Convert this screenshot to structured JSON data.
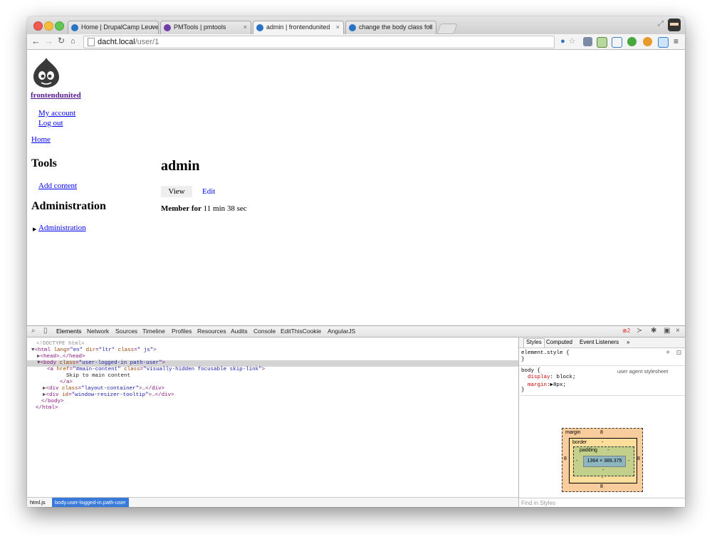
{
  "browser": {
    "tabs": [
      {
        "title": "Home | DrupalCamp Leuve",
        "close": "×",
        "color": "#2a73c4"
      },
      {
        "title": "PMTools | pmtools",
        "close": "×",
        "color": "#6f3fa8"
      },
      {
        "title": "admin | frontendunited",
        "close": "×",
        "color": "#2a73c4"
      },
      {
        "title": "change the body class foll",
        "close": "×",
        "color": "#2a73c4"
      }
    ],
    "url_host": "dacht.local",
    "url_path": "/user/1"
  },
  "page": {
    "site_name": "frontendunited",
    "user_menu": [
      "My account",
      "Log out"
    ],
    "breadcrumb": "Home",
    "tools_heading": "Tools",
    "add_content": "Add content",
    "admin_heading": "Administration",
    "admin_link": "Administration",
    "title": "admin",
    "local_tabs": [
      "View",
      "Edit"
    ],
    "member_label": "Member for",
    "member_value": " 11 min 38 sec"
  },
  "devtools": {
    "tabs": [
      "Elements",
      "Network",
      "Sources",
      "Timeline",
      "Profiles",
      "Resources",
      "Audits",
      "Console",
      "EditThisCookie",
      "AngularJS"
    ],
    "error_count": "2",
    "dom": {
      "doctype": "<!DOCTYPE html>",
      "html_open": "<html",
      "html_lang_attr": "lang",
      "html_lang_val": "\"en\"",
      "html_dir_attr": "dir",
      "html_dir_val": "\"ltr\"",
      "html_class_attr": "class",
      "html_class_val": "\" js\"",
      "head": "<head>…</head>",
      "body_open": "<body",
      "body_class_attr": "class",
      "body_class_val": "\"user-logged-in path-user\"",
      "a_open": "<a",
      "a_href_attr": "href",
      "a_href_val": "\"#main-content\"",
      "a_class_attr": "class",
      "a_class_val": "\"visually-hidden focusable skip-link\"",
      "a_text": "Skip to main content",
      "a_close": "</a>",
      "div1_open": "<div",
      "div1_attr": "class",
      "div1_val": "\"layout-container\"",
      "div1_rest": ">…</div>",
      "div2_open": "<div",
      "div2_attr": "id",
      "div2_val": "\"window-resizer-tooltip\"",
      "div2_rest": ">…</div>",
      "body_close": "</body>",
      "html_close": "</html>"
    },
    "status_crumbs": [
      "html.js",
      "body.user-logged-in.path-user"
    ],
    "styles_tabs": [
      "Styles",
      "Computed",
      "Event Listeners",
      "»"
    ],
    "element_style": "element.style {",
    "close_brace": "}",
    "body_selector": "body {",
    "ua_source": "user agent stylesheet",
    "prop_display": "display",
    "val_display": "block;",
    "prop_margin": "margin",
    "val_margin": "8px;",
    "box": {
      "margin_label": "margin",
      "margin_value": "8",
      "border_label": "border",
      "border_value": "-",
      "padding_label": "padding",
      "padding_value": "-",
      "content": "1364 × 389.375"
    },
    "find_placeholder": "Find in Styles"
  }
}
